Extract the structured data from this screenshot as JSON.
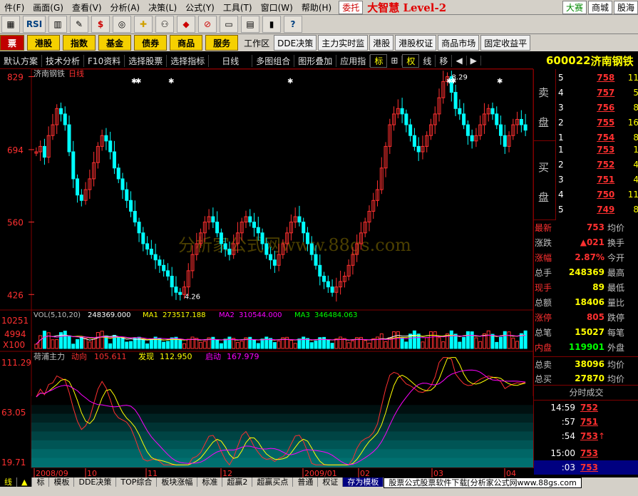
{
  "menu": {
    "items": [
      "件(F)",
      "画面(G)",
      "查看(V)",
      "分析(A)",
      "决策(L)",
      "公式(Y)",
      "工具(T)",
      "窗口(W)",
      "帮助(H)"
    ],
    "weituo": "委托",
    "brand": "大智慧 Level-2",
    "right": [
      "大赛",
      "商城",
      "股海"
    ]
  },
  "toolbar": {
    "rsi": "RSI"
  },
  "nav": {
    "left": "票",
    "yellow": [
      "港股",
      "指数",
      "基金",
      "债券",
      "商品",
      "服务"
    ],
    "workspace": "工作区",
    "plain": [
      "DDE决策",
      "主力实时监",
      "港股",
      "港股权证",
      "商品市场",
      "固定收益平"
    ]
  },
  "tabs": [
    "默认方案",
    "技术分析",
    "F10资料",
    "选择股票",
    "选择指标",
    "日线",
    "多图组合",
    "图形叠加",
    "应用指",
    "标",
    "权",
    "线",
    "移"
  ],
  "code": {
    "number": "600022",
    "name": "济南钢铁"
  },
  "colors": {
    "up": "#ff3030",
    "down": "#00ffff",
    "yellow": "#ffff00",
    "magenta": "#ff00ff",
    "white": "#ffffff",
    "bg": "#000000"
  },
  "chart_data": [
    {
      "type": "candlestick",
      "title": "济南钢铁",
      "period": "日线",
      "y_ticks": [
        829,
        694,
        560,
        426
      ],
      "y_range": [
        400,
        835
      ],
      "annotations": [
        {
          "label": "8.29",
          "value": 829
        },
        {
          "label": "4.26",
          "value": 426
        }
      ],
      "x_labels": [
        "2008/09",
        "10",
        "11",
        "12",
        "2009/01",
        "02",
        "03",
        "04"
      ],
      "series": [
        {
          "values": [
            690,
            700,
            680,
            720,
            740,
            770,
            760,
            740,
            690,
            640,
            610,
            600,
            620,
            640,
            670,
            700,
            720,
            710,
            690,
            660,
            640,
            620,
            600,
            580,
            560,
            540,
            520,
            510,
            500,
            490,
            480,
            470,
            460,
            440,
            430,
            426,
            440,
            470,
            500,
            520,
            540,
            560,
            570,
            560,
            540,
            520,
            510,
            500,
            520,
            540,
            560,
            570,
            560,
            550,
            540,
            520,
            500,
            490,
            480,
            500,
            520,
            540,
            560,
            570,
            560,
            540,
            520,
            500,
            480,
            460,
            450,
            440,
            430,
            440,
            450,
            460,
            480,
            500,
            520,
            540,
            560,
            580,
            600,
            620,
            660,
            700,
            740,
            760,
            770,
            760,
            740,
            720,
            700,
            690,
            700,
            720,
            740,
            760,
            790,
            820,
            829,
            800,
            770,
            760,
            740,
            720,
            710,
            720,
            740,
            760,
            770,
            760,
            740,
            720,
            700,
            720,
            740,
            750,
            740,
            730
          ]
        }
      ]
    },
    {
      "type": "bar",
      "title": "VOL(5,10,20)",
      "y_ticks": [
        10251,
        4994
      ],
      "unit_label": "X100",
      "series": [
        {
          "name": "VOL",
          "value": "248369.000"
        },
        {
          "name": "MA1",
          "value": "273517.188"
        },
        {
          "name": "MA2",
          "value": "310544.000"
        },
        {
          "name": "MA3",
          "value": "346484.063"
        }
      ]
    },
    {
      "type": "line",
      "title": "荷浦主力",
      "y_ticks": [
        111.29,
        63.05,
        19.71
      ],
      "series": [
        {
          "name": "动向",
          "value": "105.611"
        },
        {
          "name": "发现",
          "value": "112.950"
        },
        {
          "name": "启动",
          "value": "167.979"
        }
      ]
    }
  ],
  "watermark": "分析家公式网www.88gs.com",
  "orderbook": {
    "sell_label": [
      "卖",
      "盘"
    ],
    "buy_label": [
      "买",
      "盘"
    ],
    "sells": [
      {
        "lv": "5",
        "price": "758",
        "vol": "11"
      },
      {
        "lv": "4",
        "price": "757",
        "vol": "5"
      },
      {
        "lv": "3",
        "price": "756",
        "vol": "8"
      },
      {
        "lv": "2",
        "price": "755",
        "vol": "16"
      },
      {
        "lv": "1",
        "price": "754",
        "vol": "8"
      }
    ],
    "buys": [
      {
        "lv": "1",
        "price": "753",
        "vol": "1"
      },
      {
        "lv": "2",
        "price": "752",
        "vol": "4"
      },
      {
        "lv": "3",
        "price": "751",
        "vol": "4"
      },
      {
        "lv": "4",
        "price": "750",
        "vol": "11"
      },
      {
        "lv": "5",
        "price": "749",
        "vol": "8"
      }
    ]
  },
  "stats": [
    {
      "label": "最新",
      "value": "753",
      "label2": "均价"
    },
    {
      "label": "涨跌",
      "value": "▲021",
      "label2": "换手"
    },
    {
      "label": "涨幅",
      "value": "2.87%",
      "label2": "今开"
    },
    {
      "label": "总手",
      "value": "248369",
      "label2": "最高"
    },
    {
      "label": "现手",
      "value": "89",
      "label2": "最低"
    },
    {
      "label": "总额",
      "value": "18406",
      "label2": "量比"
    },
    {
      "label": "涨停",
      "value": "805",
      "label2": "跌停"
    },
    {
      "label": "总笔",
      "value": "15027",
      "label2": "每笔"
    },
    {
      "label": "内盘",
      "value": "119901",
      "label2": "外盘"
    },
    {
      "label": "总卖",
      "value": "38096",
      "label2": "均价"
    },
    {
      "label": "总买",
      "value": "27870",
      "label2": "均价"
    }
  ],
  "ticks": {
    "title": "分时成交",
    "rows": [
      {
        "time": "14:59",
        "price": "752",
        "arrow": ""
      },
      {
        "time": ":57",
        "price": "751",
        "arrow": ""
      },
      {
        "time": ":54",
        "price": "753",
        "arrow": "↑"
      },
      {
        "time": "15:00",
        "price": "753",
        "arrow": ""
      },
      {
        "time": ":03",
        "price": "753",
        "arrow": ""
      }
    ]
  },
  "bottom": {
    "left": "线",
    "tabs": [
      "标",
      "模板",
      "DDE决策",
      "TOP综合",
      "板块涨幅",
      "标准",
      "超赢2",
      "超赢买点",
      "普通",
      "权证",
      "存为模板",
      "股票公式股票软件下载[分析家公式网www.88gs.com"
    ]
  }
}
